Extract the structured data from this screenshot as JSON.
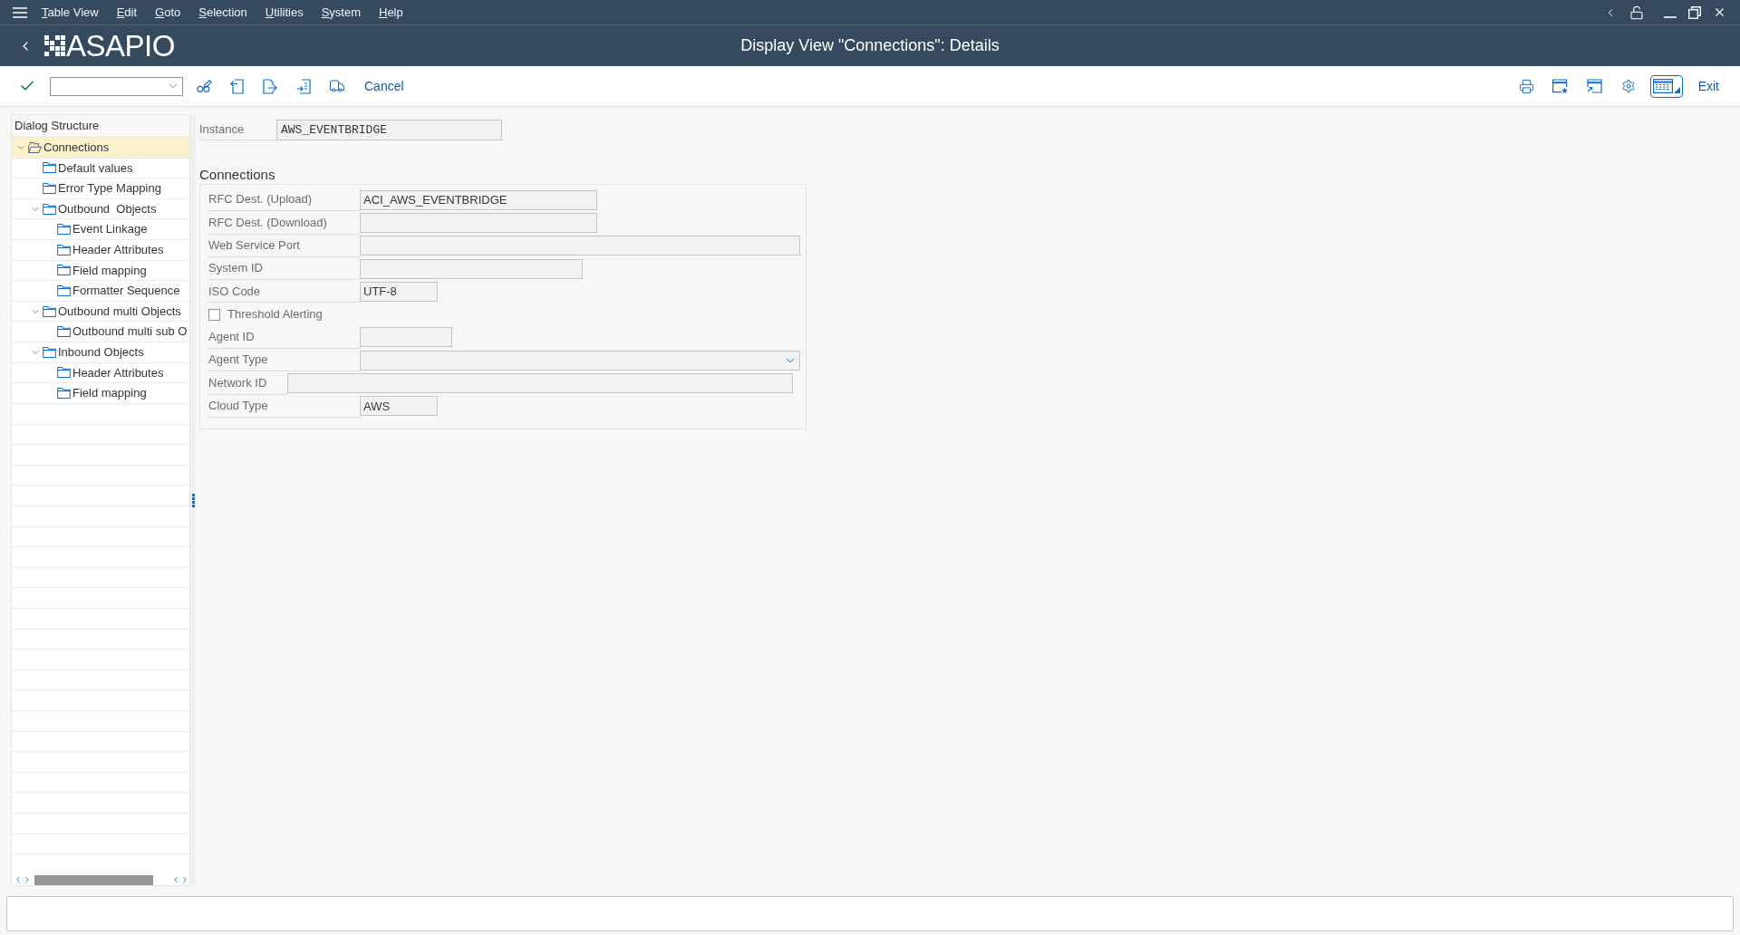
{
  "menu_bar": {
    "items": [
      "Table View",
      "Edit",
      "Goto",
      "Selection",
      "Utilities",
      "System",
      "Help"
    ]
  },
  "header": {
    "logo_text": "ASAPIO",
    "title": "Display View \"Connections\": Details"
  },
  "toolbar": {
    "cancel_label": "Cancel",
    "exit_label": "Exit"
  },
  "dialog_structure": {
    "title": "Dialog Structure",
    "items": [
      {
        "label": "Connections",
        "selected": true,
        "expanded": true,
        "children": [
          {
            "label": "Default values",
            "selected": false,
            "expanded": false
          },
          {
            "label": "Error Type Mapping",
            "selected": false,
            "expanded": false
          },
          {
            "label": "Outbound  Objects",
            "selected": false,
            "expanded": true,
            "children": [
              {
                "label": "Event Linkage",
                "selected": false,
                "expanded": false
              },
              {
                "label": "Header Attributes",
                "selected": false,
                "expanded": false
              },
              {
                "label": "Field mapping",
                "selected": false,
                "expanded": false
              },
              {
                "label": "Formatter Sequence",
                "selected": false,
                "expanded": false
              }
            ]
          },
          {
            "label": "Outbound multi Objects",
            "selected": false,
            "expanded": true,
            "children": [
              {
                "label": "Outbound multi sub O",
                "selected": false,
                "expanded": false
              }
            ]
          },
          {
            "label": "Inbound Objects",
            "selected": false,
            "expanded": true,
            "children": [
              {
                "label": "Header Attributes",
                "selected": false,
                "expanded": false
              },
              {
                "label": "Field mapping",
                "selected": false,
                "expanded": false
              }
            ]
          }
        ]
      }
    ]
  },
  "instance": {
    "label": "Instance",
    "value": "AWS_EVENTBRIDGE"
  },
  "connections": {
    "title": "Connections",
    "fields": [
      {
        "kind": "text",
        "label": "RFC Dest. (Upload)",
        "value": "ACI_AWS_EVENTBRIDGE"
      },
      {
        "kind": "text",
        "label": "RFC Dest. (Download)"
      },
      {
        "kind": "text",
        "label": "Web Service Port"
      },
      {
        "kind": "text",
        "label": "System ID"
      },
      {
        "kind": "text",
        "label": "ISO Code",
        "value": "UTF-8"
      },
      {
        "kind": "checkbox",
        "label": "Threshold Alerting",
        "checked": false
      },
      {
        "kind": "text",
        "label": "Agent ID"
      },
      {
        "kind": "dropdown",
        "label": "Agent Type"
      },
      {
        "kind": "text",
        "label": "Network ID"
      },
      {
        "kind": "text",
        "label": "Cloud Type",
        "value": "AWS"
      }
    ]
  }
}
